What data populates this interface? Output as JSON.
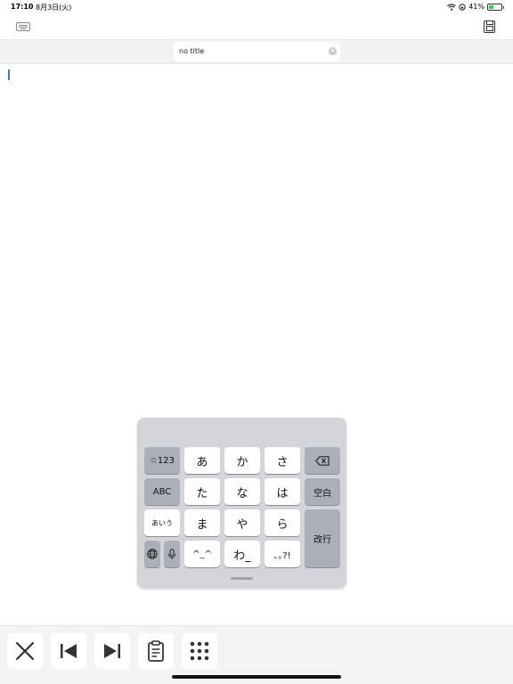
{
  "status_bar": {
    "time": "17:10",
    "date": "8月3日(火)",
    "battery_pct_text": "41%",
    "battery_level": 0.41
  },
  "top_toolbar": {
    "keyboard_icon": "keyboard-icon",
    "save_icon": "floppy-disk-icon"
  },
  "title_field": {
    "value": "no title",
    "clear_icon": "clear-circle-icon"
  },
  "editor": {
    "text": ""
  },
  "keyboard": {
    "rows": [
      [
        "☆123",
        "あ",
        "か",
        "さ",
        "⌫"
      ],
      [
        "ABC",
        "た",
        "な",
        "は",
        "空白"
      ],
      [
        "あいう",
        "ま",
        "や",
        "ら",
        "改行"
      ],
      [
        "🌐",
        "🎤",
        "^^",
        "わ_",
        "､｡?!"
      ]
    ],
    "keys": {
      "mode_num": "☆123",
      "a": "あ",
      "ka": "か",
      "sa": "さ",
      "mode_abc": "ABC",
      "ta": "た",
      "na": "な",
      "ha": "は",
      "space": "空白",
      "mode_kana": "あいう",
      "ma": "ま",
      "ya": "や",
      "ra": "ら",
      "return": "改行",
      "kaomoji": "^_^",
      "wa": "わ_",
      "punct": "､｡?!"
    },
    "icons": [
      "delete-icon",
      "globe-icon",
      "microphone-icon"
    ]
  },
  "bottom_toolbar": {
    "buttons": [
      "close-icon",
      "skip-back-icon",
      "skip-forward-icon",
      "clipboard-icon",
      "grid-icon"
    ]
  },
  "colors": {
    "caret": "#3d6ef5",
    "keyboard_bg": "#d4d5da",
    "dark_key": "#acafb8",
    "battery_fill": "#34c759"
  }
}
